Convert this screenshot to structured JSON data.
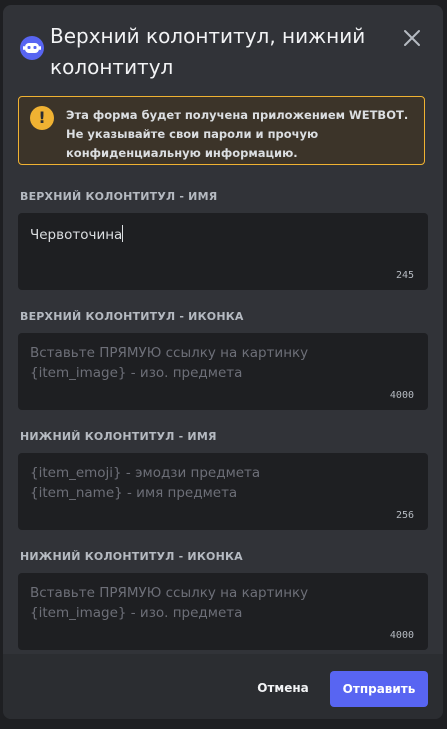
{
  "modal": {
    "title": "Верхний колонтитул, нижний колонтитул",
    "notice": {
      "text_before": "Эта форма будет получена приложением ",
      "app_name": "WETBOT",
      "text_after": ". Не указывайте свои пароли и прочую конфиденциальную информацию."
    },
    "fields": [
      {
        "label": "ВЕРХНИЙ КОЛОНТИТУЛ - ИМЯ",
        "value": "Червоточина",
        "placeholder": "",
        "counter": "245"
      },
      {
        "label": "ВЕРХНИЙ КОЛОНТИТУЛ - ИКОНКА",
        "value": "",
        "placeholder_line1": "Вставьте ПРЯМУЮ ссылку на картинку",
        "placeholder_line2": "{item_image} - изо. предмета",
        "counter": "4000"
      },
      {
        "label": "НИЖНИЙ КОЛОНТИТУЛ - ИМЯ",
        "value": "",
        "placeholder_line1": "{item_emoji} - эмодзи предмета",
        "placeholder_line2": "{item_name} - имя предмета",
        "counter": "256"
      },
      {
        "label": "НИЖНИЙ КОЛОНТИТУЛ - ИКОНКА",
        "value": "",
        "placeholder_line1": "Вставьте ПРЯМУЮ ссылку на картинку",
        "placeholder_line2": "{item_image} - изо. предмета",
        "counter": "4000"
      }
    ],
    "footer": {
      "cancel_label": "Отмена",
      "submit_label": "Отправить"
    }
  },
  "icons": {
    "avatar": "bot-avatar-icon",
    "close": "close-icon",
    "warning": "warning-icon"
  },
  "colors": {
    "accent": "#5865f2",
    "warning": "#f0b232",
    "background": "#313338",
    "input": "#1e1f22"
  }
}
